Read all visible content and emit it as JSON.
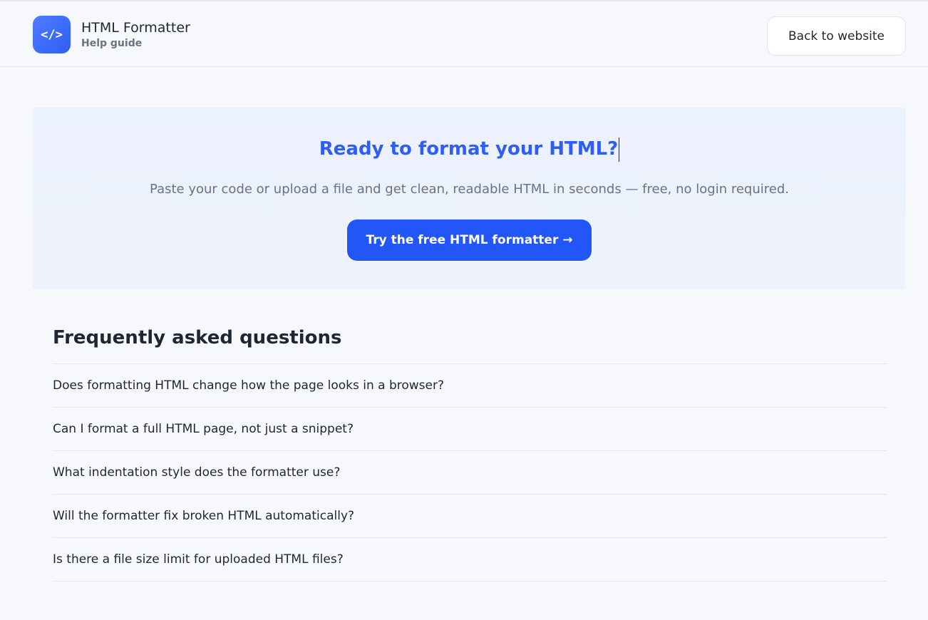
{
  "header": {
    "app_title": "HTML Formatter",
    "subtitle": "Help guide",
    "logo_icon": "code-brackets-icon",
    "logo_glyph": "</>",
    "back_label": "Back to website"
  },
  "hero": {
    "title": "Ready to format your HTML?",
    "subtitle": "Paste your code or upload a file and get clean, readable HTML in seconds — free, no login required.",
    "cta_label": "Try the free HTML formatter →"
  },
  "faq": {
    "title": "Frequently asked questions",
    "items": [
      {
        "question": "Does formatting HTML change how the page looks in a browser?"
      },
      {
        "question": "Can I format a full HTML page, not just a snippet?"
      },
      {
        "question": "What indentation style does the formatter use?"
      },
      {
        "question": "Will the formatter fix broken HTML automatically?"
      },
      {
        "question": "Is there a file size limit for uploaded HTML files?"
      }
    ]
  },
  "colors": {
    "accent": "#2356f6",
    "hero_title": "#2f5ef5",
    "background": "#f6f8fc",
    "hero_background": "#ecf1fd"
  }
}
